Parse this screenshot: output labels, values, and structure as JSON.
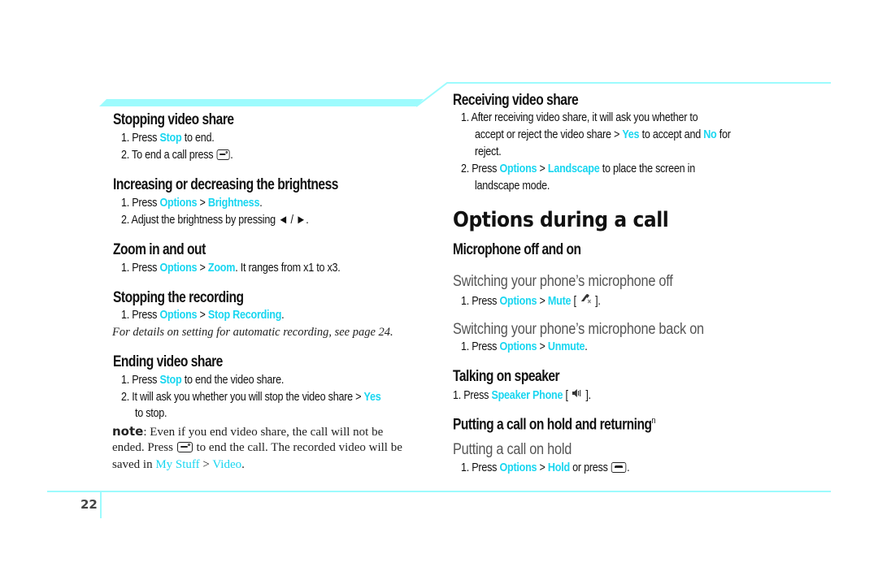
{
  "colors": {
    "accent": "#19d6f0",
    "rule": "#9dfbfd"
  },
  "left": {
    "stopping_video_share": {
      "heading": "Stopping video share",
      "step1": {
        "pre": "1. Press ",
        "hl": "Stop",
        "post": " to end."
      },
      "step2": {
        "pre": "2. To end a call press ",
        "icon": "end-call-key-icon",
        "post": "."
      }
    },
    "brightness": {
      "heading": "Increasing or decreasing the brightness",
      "step1": {
        "pre": "1. Press ",
        "hl1": "Options",
        "sep": " > ",
        "hl2": "Brightness",
        "post": "."
      },
      "step2": {
        "text": "2. Adjust the brightness by pressing ◄ / ►."
      }
    },
    "zoom": {
      "heading": "Zoom in and out",
      "step1": {
        "pre": "1. Press ",
        "hl1": "Options",
        "sep": " > ",
        "hl2": "Zoom",
        "post": ". It ranges from x1 to x3."
      }
    },
    "stop_recording": {
      "heading": "Stopping the recording",
      "step1": {
        "pre": "1. Press ",
        "hl1": "Options",
        "sep": " > ",
        "hl2": "Stop Recording",
        "post": "."
      },
      "note": "For details on setting for automatic recording, see page 24."
    },
    "ending_video_share": {
      "heading": "Ending video share",
      "step1": {
        "pre": "1. Press ",
        "hl": "Stop",
        "post": " to end the video share."
      },
      "step2": {
        "pre": "2. It will ask you whether you will stop the video share > ",
        "hl": "Yes",
        "line2": "to stop."
      },
      "note": {
        "label": "note",
        "line1": ": Even if you end video share, the call will not be",
        "line2_pre": "ended. Press ",
        "line2_post": " to end the call. The recorded video will be",
        "line3_pre": "saved in ",
        "hl1": "My Stuff",
        "sep": " > ",
        "hl2": "Video",
        "line3_post": "."
      }
    }
  },
  "right": {
    "receiving_video_share": {
      "heading": "Receiving video share",
      "step1": {
        "line1": "1. After receiving video share, it will ask you whether to",
        "line2_pre": "accept or reject the video share > ",
        "hl1": "Yes",
        "mid": " to accept and ",
        "hl2": "No",
        "line2_post": " for",
        "line3": "reject."
      },
      "step2": {
        "pre": "2. Press ",
        "hl1": "Options",
        "sep": " > ",
        "hl2": "Landscape",
        "post": " to place the screen in",
        "line2": "landscape mode."
      }
    },
    "section_title": "Options during a call",
    "microphone": {
      "heading": "Microphone off and on",
      "off": {
        "subheading": "Switching your phone’s microphone off",
        "step1": {
          "pre": "1. Press ",
          "hl1": "Options",
          "sep": " > ",
          "hl2": "Mute",
          "post_open": " [ ",
          "icon": "mute-icon",
          "post_close": " ]."
        }
      },
      "on": {
        "subheading": "Switching your phone’s microphone back on",
        "step1": {
          "pre": "1. Press ",
          "hl1": "Options",
          "sep": " > ",
          "hl2": "Unmute",
          "post": "."
        }
      }
    },
    "speaker": {
      "heading": "Talking on speaker",
      "step1": {
        "pre": "1. Press ",
        "hl": "Speaker Phone",
        "post_open": " [ ",
        "icon": "speaker-icon",
        "post_close": " ]."
      }
    },
    "hold": {
      "heading": "Putting a call on hold and returning",
      "heading_sup": "n",
      "subheading": "Putting a call on hold",
      "step1": {
        "pre": "1. Press ",
        "hl1": "Options",
        "sep": " > ",
        "hl2": "Hold",
        "post": " or press ",
        "end": "."
      }
    }
  },
  "footer": {
    "page_number": "22"
  }
}
